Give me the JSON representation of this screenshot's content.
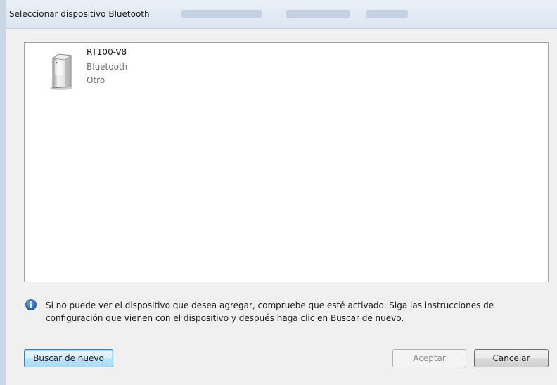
{
  "window": {
    "title": "Seleccionar dispositivo Bluetooth"
  },
  "device_list": {
    "items": [
      {
        "name": "RT100-V8",
        "type": "Bluetooth",
        "category": "Otro",
        "icon": "generic-device-icon"
      }
    ]
  },
  "info": {
    "icon": "info-icon",
    "message": "Si no puede ver el dispositivo que desea agregar, compruebe que esté activado. Siga las instrucciones de configuración que vienen con el dispositivo y después haga clic en Buscar de nuevo."
  },
  "buttons": {
    "search_again": "Buscar de nuevo",
    "accept": "Aceptar",
    "cancel": "Cancelar"
  }
}
